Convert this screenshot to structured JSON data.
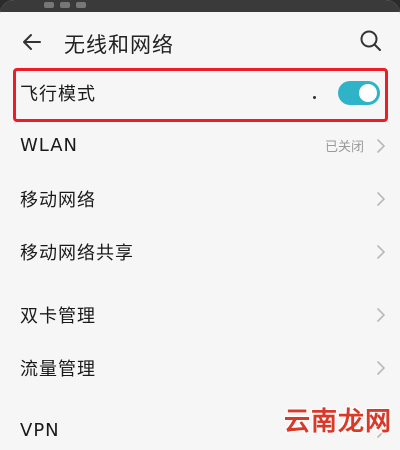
{
  "header": {
    "title": "无线和网络",
    "back_icon": "back-arrow-icon",
    "search_icon": "search-icon"
  },
  "rows": [
    {
      "label": "飞行模式",
      "control": "toggle",
      "toggle_on": true,
      "highlighted": true
    },
    {
      "label": "WLAN",
      "value": "已关闭"
    },
    {
      "label": "移动网络"
    },
    {
      "label": "移动网络共享"
    },
    {
      "label": "双卡管理"
    },
    {
      "label": "流量管理"
    },
    {
      "label": "VPN"
    }
  ],
  "watermark": "云南龙网",
  "colors": {
    "accent": "#2fb3c9",
    "highlight_border": "#ee1c25",
    "watermark": "#d83a2a",
    "background": "#f6f6f6"
  }
}
